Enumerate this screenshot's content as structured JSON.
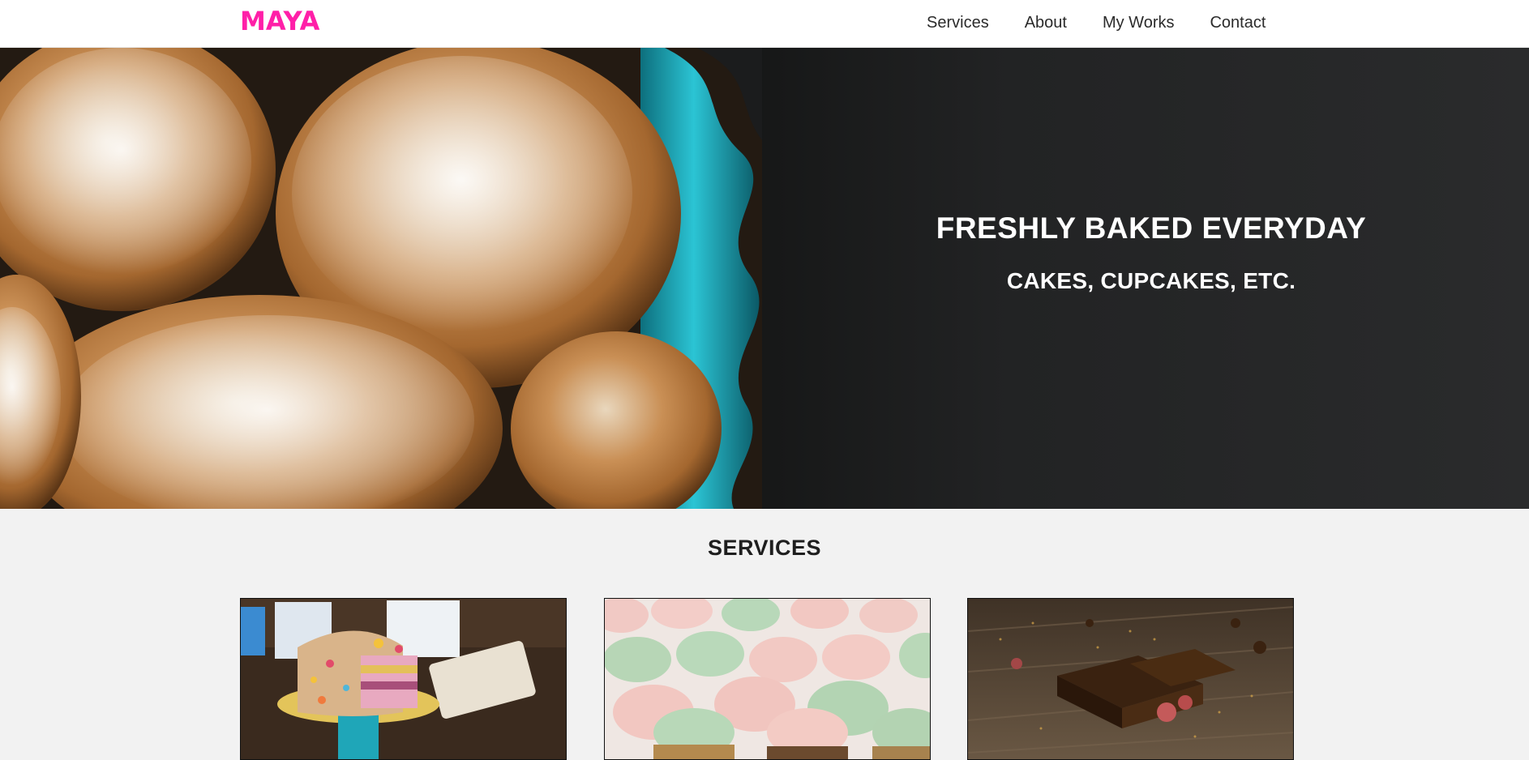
{
  "brand": {
    "logo": "MAYA",
    "color": "#ff1fa8"
  },
  "nav": {
    "items": [
      {
        "label": "Services"
      },
      {
        "label": "About"
      },
      {
        "label": "My Works"
      },
      {
        "label": "Contact"
      }
    ]
  },
  "hero": {
    "title": "FRESHLY BAKED EVERYDAY",
    "subtitle": "CAKES, CUPCAKES, ETC.",
    "image": "bread-rolls-in-teal-dish"
  },
  "services": {
    "title": "SERVICES",
    "cards": [
      {
        "image": "sprinkle-layer-cake-on-stand"
      },
      {
        "image": "pastel-cupcakes-tray"
      },
      {
        "image": "chocolate-brownies-on-wood"
      }
    ]
  }
}
